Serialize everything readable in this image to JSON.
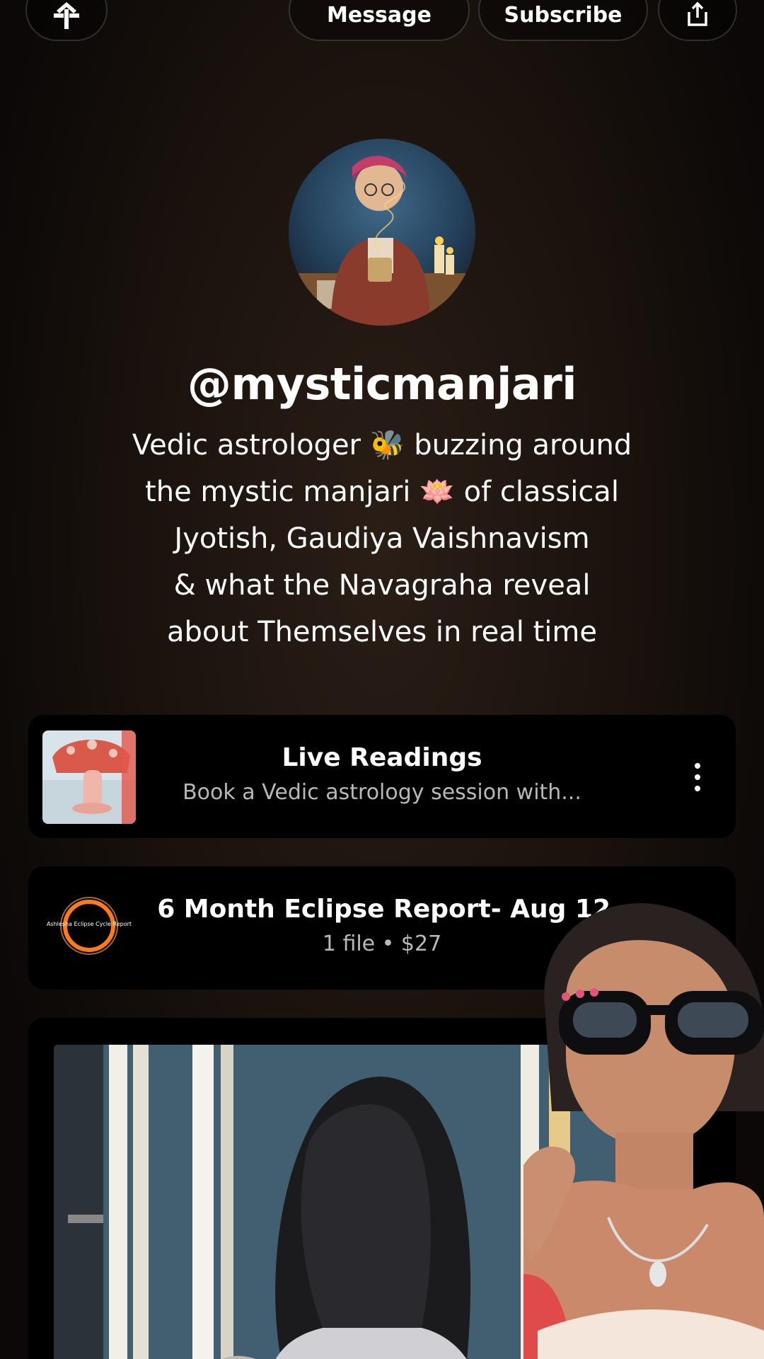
{
  "header": {
    "message_label": "Message",
    "subscribe_label": "Subscribe",
    "logo_icon": "linktree-logo-icon",
    "share_icon": "share-icon"
  },
  "profile": {
    "username": "@mysticmanjari",
    "bio_lines": [
      "Vedic astrologer 🐝 buzzing around",
      "the mystic manjari 🪷 of classical",
      "Jyotish, Gaudiya Vaishnavism",
      "& what the Navagraha reveal",
      "about Themselves in real time"
    ]
  },
  "links": [
    {
      "title": "Live Readings",
      "subtitle": "Book a Vedic astrology session with..."
    },
    {
      "title": "6 Month Eclipse Report- Aug 12,...",
      "subtitle": "1 file • $27",
      "thumb_text": "Ashlesha Eclipse Cycle Report"
    }
  ],
  "colors": {
    "background": "#1a120d",
    "card": "#000000",
    "text": "#ffffff",
    "muted": "#b8b8b8"
  }
}
